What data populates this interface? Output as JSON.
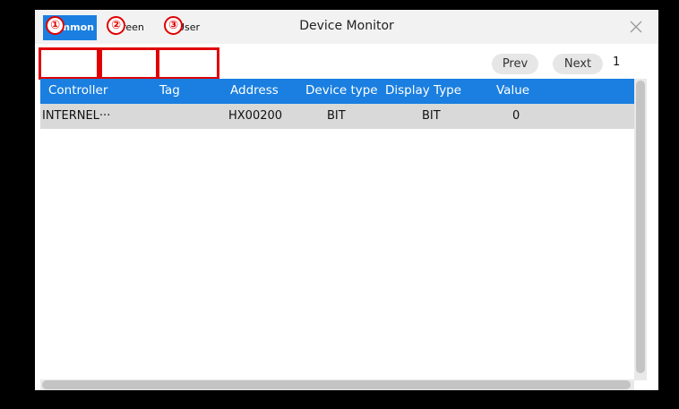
{
  "window": {
    "title": "Device Monitor"
  },
  "tabs": [
    {
      "label": "Common",
      "active": true
    },
    {
      "label": "Screen",
      "active": false
    },
    {
      "label": "User",
      "active": false
    }
  ],
  "annotations": {
    "markers": [
      "①",
      "②",
      "③"
    ],
    "color": "#e00000"
  },
  "pager": {
    "prev_label": "Prev",
    "next_label": "Next",
    "page": "1"
  },
  "table": {
    "columns": [
      "Controller",
      "Tag",
      "Address",
      "Device type",
      "Display Type",
      "Value"
    ],
    "rows": [
      {
        "controller": "INTERNEL···",
        "tag": "",
        "address": "HX00200",
        "device_type": "BIT",
        "display_type": "BIT",
        "value": "0"
      }
    ]
  },
  "colors": {
    "accent": "#1a7fe0",
    "selected_row": "#d9d9d9"
  },
  "icons": {
    "close": "close-icon"
  }
}
